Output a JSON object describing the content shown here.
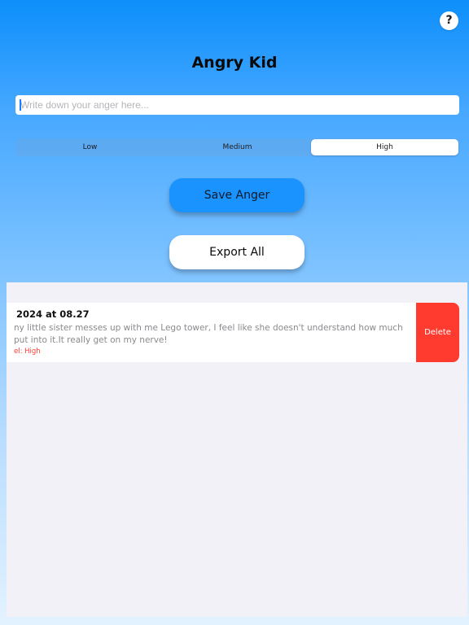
{
  "header": {
    "help_label": "?",
    "title": "Angry Kid"
  },
  "input": {
    "placeholder": "Write down your anger here..."
  },
  "level_selector": {
    "options": [
      "Low",
      "Medium",
      "High"
    ],
    "selected": "High"
  },
  "actions": {
    "save_label": "Save Anger",
    "export_label": "Export All"
  },
  "entries": [
    {
      "date": "2024 at 08.27",
      "text_line1": "ny little sister messes up with me Lego tower, I feel like she doesn't understand how much",
      "text_line2": "put into it.It really get on my nerve!",
      "level": "el: High",
      "delete_label": "Delete"
    }
  ],
  "colors": {
    "accent": "#1a93ff",
    "destructive": "#ff3b30",
    "list_background": "#f2f1f7"
  },
  "icons": {
    "help": "question-mark-icon"
  }
}
